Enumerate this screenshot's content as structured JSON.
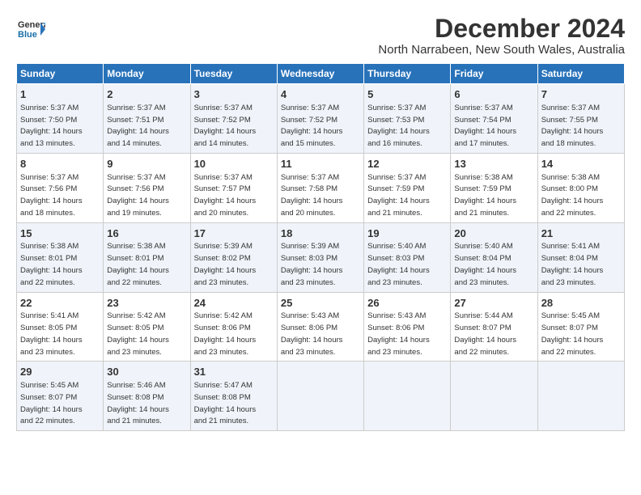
{
  "header": {
    "logo_line1": "General",
    "logo_line2": "Blue",
    "title": "December 2024",
    "subtitle": "North Narrabeen, New South Wales, Australia"
  },
  "columns": [
    "Sunday",
    "Monday",
    "Tuesday",
    "Wednesday",
    "Thursday",
    "Friday",
    "Saturday"
  ],
  "weeks": [
    [
      {
        "day": "1",
        "info": "Sunrise: 5:37 AM\nSunset: 7:50 PM\nDaylight: 14 hours\nand 13 minutes."
      },
      {
        "day": "2",
        "info": "Sunrise: 5:37 AM\nSunset: 7:51 PM\nDaylight: 14 hours\nand 14 minutes."
      },
      {
        "day": "3",
        "info": "Sunrise: 5:37 AM\nSunset: 7:52 PM\nDaylight: 14 hours\nand 14 minutes."
      },
      {
        "day": "4",
        "info": "Sunrise: 5:37 AM\nSunset: 7:52 PM\nDaylight: 14 hours\nand 15 minutes."
      },
      {
        "day": "5",
        "info": "Sunrise: 5:37 AM\nSunset: 7:53 PM\nDaylight: 14 hours\nand 16 minutes."
      },
      {
        "day": "6",
        "info": "Sunrise: 5:37 AM\nSunset: 7:54 PM\nDaylight: 14 hours\nand 17 minutes."
      },
      {
        "day": "7",
        "info": "Sunrise: 5:37 AM\nSunset: 7:55 PM\nDaylight: 14 hours\nand 18 minutes."
      }
    ],
    [
      {
        "day": "8",
        "info": "Sunrise: 5:37 AM\nSunset: 7:56 PM\nDaylight: 14 hours\nand 18 minutes."
      },
      {
        "day": "9",
        "info": "Sunrise: 5:37 AM\nSunset: 7:56 PM\nDaylight: 14 hours\nand 19 minutes."
      },
      {
        "day": "10",
        "info": "Sunrise: 5:37 AM\nSunset: 7:57 PM\nDaylight: 14 hours\nand 20 minutes."
      },
      {
        "day": "11",
        "info": "Sunrise: 5:37 AM\nSunset: 7:58 PM\nDaylight: 14 hours\nand 20 minutes."
      },
      {
        "day": "12",
        "info": "Sunrise: 5:37 AM\nSunset: 7:59 PM\nDaylight: 14 hours\nand 21 minutes."
      },
      {
        "day": "13",
        "info": "Sunrise: 5:38 AM\nSunset: 7:59 PM\nDaylight: 14 hours\nand 21 minutes."
      },
      {
        "day": "14",
        "info": "Sunrise: 5:38 AM\nSunset: 8:00 PM\nDaylight: 14 hours\nand 22 minutes."
      }
    ],
    [
      {
        "day": "15",
        "info": "Sunrise: 5:38 AM\nSunset: 8:01 PM\nDaylight: 14 hours\nand 22 minutes."
      },
      {
        "day": "16",
        "info": "Sunrise: 5:38 AM\nSunset: 8:01 PM\nDaylight: 14 hours\nand 22 minutes."
      },
      {
        "day": "17",
        "info": "Sunrise: 5:39 AM\nSunset: 8:02 PM\nDaylight: 14 hours\nand 23 minutes."
      },
      {
        "day": "18",
        "info": "Sunrise: 5:39 AM\nSunset: 8:03 PM\nDaylight: 14 hours\nand 23 minutes."
      },
      {
        "day": "19",
        "info": "Sunrise: 5:40 AM\nSunset: 8:03 PM\nDaylight: 14 hours\nand 23 minutes."
      },
      {
        "day": "20",
        "info": "Sunrise: 5:40 AM\nSunset: 8:04 PM\nDaylight: 14 hours\nand 23 minutes."
      },
      {
        "day": "21",
        "info": "Sunrise: 5:41 AM\nSunset: 8:04 PM\nDaylight: 14 hours\nand 23 minutes."
      }
    ],
    [
      {
        "day": "22",
        "info": "Sunrise: 5:41 AM\nSunset: 8:05 PM\nDaylight: 14 hours\nand 23 minutes."
      },
      {
        "day": "23",
        "info": "Sunrise: 5:42 AM\nSunset: 8:05 PM\nDaylight: 14 hours\nand 23 minutes."
      },
      {
        "day": "24",
        "info": "Sunrise: 5:42 AM\nSunset: 8:06 PM\nDaylight: 14 hours\nand 23 minutes."
      },
      {
        "day": "25",
        "info": "Sunrise: 5:43 AM\nSunset: 8:06 PM\nDaylight: 14 hours\nand 23 minutes."
      },
      {
        "day": "26",
        "info": "Sunrise: 5:43 AM\nSunset: 8:06 PM\nDaylight: 14 hours\nand 23 minutes."
      },
      {
        "day": "27",
        "info": "Sunrise: 5:44 AM\nSunset: 8:07 PM\nDaylight: 14 hours\nand 22 minutes."
      },
      {
        "day": "28",
        "info": "Sunrise: 5:45 AM\nSunset: 8:07 PM\nDaylight: 14 hours\nand 22 minutes."
      }
    ],
    [
      {
        "day": "29",
        "info": "Sunrise: 5:45 AM\nSunset: 8:07 PM\nDaylight: 14 hours\nand 22 minutes."
      },
      {
        "day": "30",
        "info": "Sunrise: 5:46 AM\nSunset: 8:08 PM\nDaylight: 14 hours\nand 21 minutes."
      },
      {
        "day": "31",
        "info": "Sunrise: 5:47 AM\nSunset: 8:08 PM\nDaylight: 14 hours\nand 21 minutes."
      },
      {
        "day": "",
        "info": ""
      },
      {
        "day": "",
        "info": ""
      },
      {
        "day": "",
        "info": ""
      },
      {
        "day": "",
        "info": ""
      }
    ]
  ]
}
